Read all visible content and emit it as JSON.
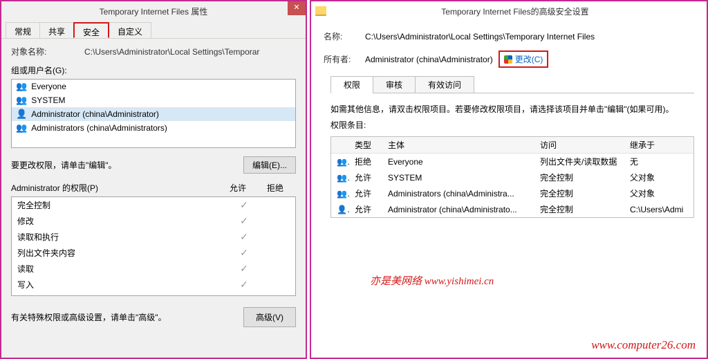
{
  "left": {
    "title": "Temporary Internet Files 属性",
    "tabs": [
      "常规",
      "共享",
      "安全",
      "自定义"
    ],
    "active_tab_index": 2,
    "object_label": "对象名称:",
    "object_value": "C:\\Users\\Administrator\\Local Settings\\Temporar",
    "groups_label": "组或用户名(G):",
    "groups": [
      {
        "icon": "👥",
        "name": "Everyone"
      },
      {
        "icon": "👥",
        "name": "SYSTEM"
      },
      {
        "icon": "👤",
        "name": "Administrator (china\\Administrator)",
        "selected": true
      },
      {
        "icon": "👥",
        "name": "Administrators (china\\Administrators)"
      }
    ],
    "edit_hint": "要更改权限，请单击\"编辑\"。",
    "edit_button": "编辑(E)...",
    "perm_label": "Administrator 的权限(P)",
    "allow_label": "允许",
    "deny_label": "拒绝",
    "permissions": [
      {
        "name": "完全控制",
        "allow": true,
        "deny": false
      },
      {
        "name": "修改",
        "allow": true,
        "deny": false
      },
      {
        "name": "读取和执行",
        "allow": true,
        "deny": false
      },
      {
        "name": "列出文件夹内容",
        "allow": true,
        "deny": false
      },
      {
        "name": "读取",
        "allow": true,
        "deny": false
      },
      {
        "name": "写入",
        "allow": true,
        "deny": false
      }
    ],
    "adv_hint": "有关特殊权限或高级设置，请单击\"高级\"。",
    "adv_button": "高级(V)"
  },
  "right": {
    "title": "Temporary Internet Files的高级安全设置",
    "name_label": "名称:",
    "name_value": "C:\\Users\\Administrator\\Local Settings\\Temporary Internet Files",
    "owner_label": "所有者:",
    "owner_value": "Administrator (china\\Administrator)",
    "change_link": "更改(C)",
    "sub_tabs": [
      "权限",
      "审核",
      "有效访问"
    ],
    "active_sub_tab": 0,
    "hint": "如需其他信息，请双击权限项目。若要修改权限项目，请选择该项目并单击\"编辑\"(如果可用)。",
    "entries_label": "权限条目:",
    "columns": {
      "type": "类型",
      "subject": "主体",
      "access": "访问",
      "inherit": "继承于"
    },
    "rows": [
      {
        "icon": "👥",
        "type": "拒绝",
        "subject": "Everyone",
        "access": "列出文件夹/读取数据",
        "inherit": "无"
      },
      {
        "icon": "👥",
        "type": "允许",
        "subject": "SYSTEM",
        "access": "完全控制",
        "inherit": "父对象"
      },
      {
        "icon": "👥",
        "type": "允许",
        "subject": "Administrators (china\\Administra...",
        "access": "完全控制",
        "inherit": "父对象"
      },
      {
        "icon": "👤",
        "type": "允许",
        "subject": "Administrator (china\\Administrato...",
        "access": "完全控制",
        "inherit": "C:\\Users\\Admi"
      }
    ]
  },
  "watermarks": {
    "w1": "亦是美网络 www.yishimei.cn",
    "w2": "www.computer26.com"
  }
}
